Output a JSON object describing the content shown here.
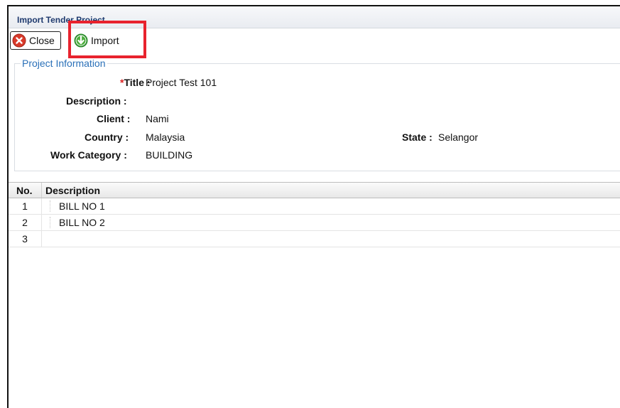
{
  "window": {
    "title": "Import Tender Project"
  },
  "toolbar": {
    "close_label": "Close",
    "import_label": "Import"
  },
  "project_info": {
    "legend": "Project Information",
    "title_label": "Title :",
    "title_required_mark": "*",
    "title_value": "Project Test 101",
    "description_label": "Description :",
    "description_value": "",
    "client_label": "Client :",
    "client_value": "Nami",
    "country_label": "Country :",
    "country_value": "Malaysia",
    "state_label": "State :",
    "state_value": "Selangor",
    "work_category_label": "Work Category :",
    "work_category_value": "BUILDING"
  },
  "grid": {
    "columns": [
      "No.",
      "Description"
    ],
    "rows": [
      {
        "no": "1",
        "description": "BILL NO 1"
      },
      {
        "no": "2",
        "description": "BILL NO 2"
      },
      {
        "no": "3",
        "description": ""
      }
    ]
  },
  "colors": {
    "highlight": "#e8232e",
    "legend": "#2a70b8",
    "title": "#1f3a6e"
  },
  "icons": {
    "close": "close-circle-icon",
    "import": "download-arrow-icon"
  }
}
